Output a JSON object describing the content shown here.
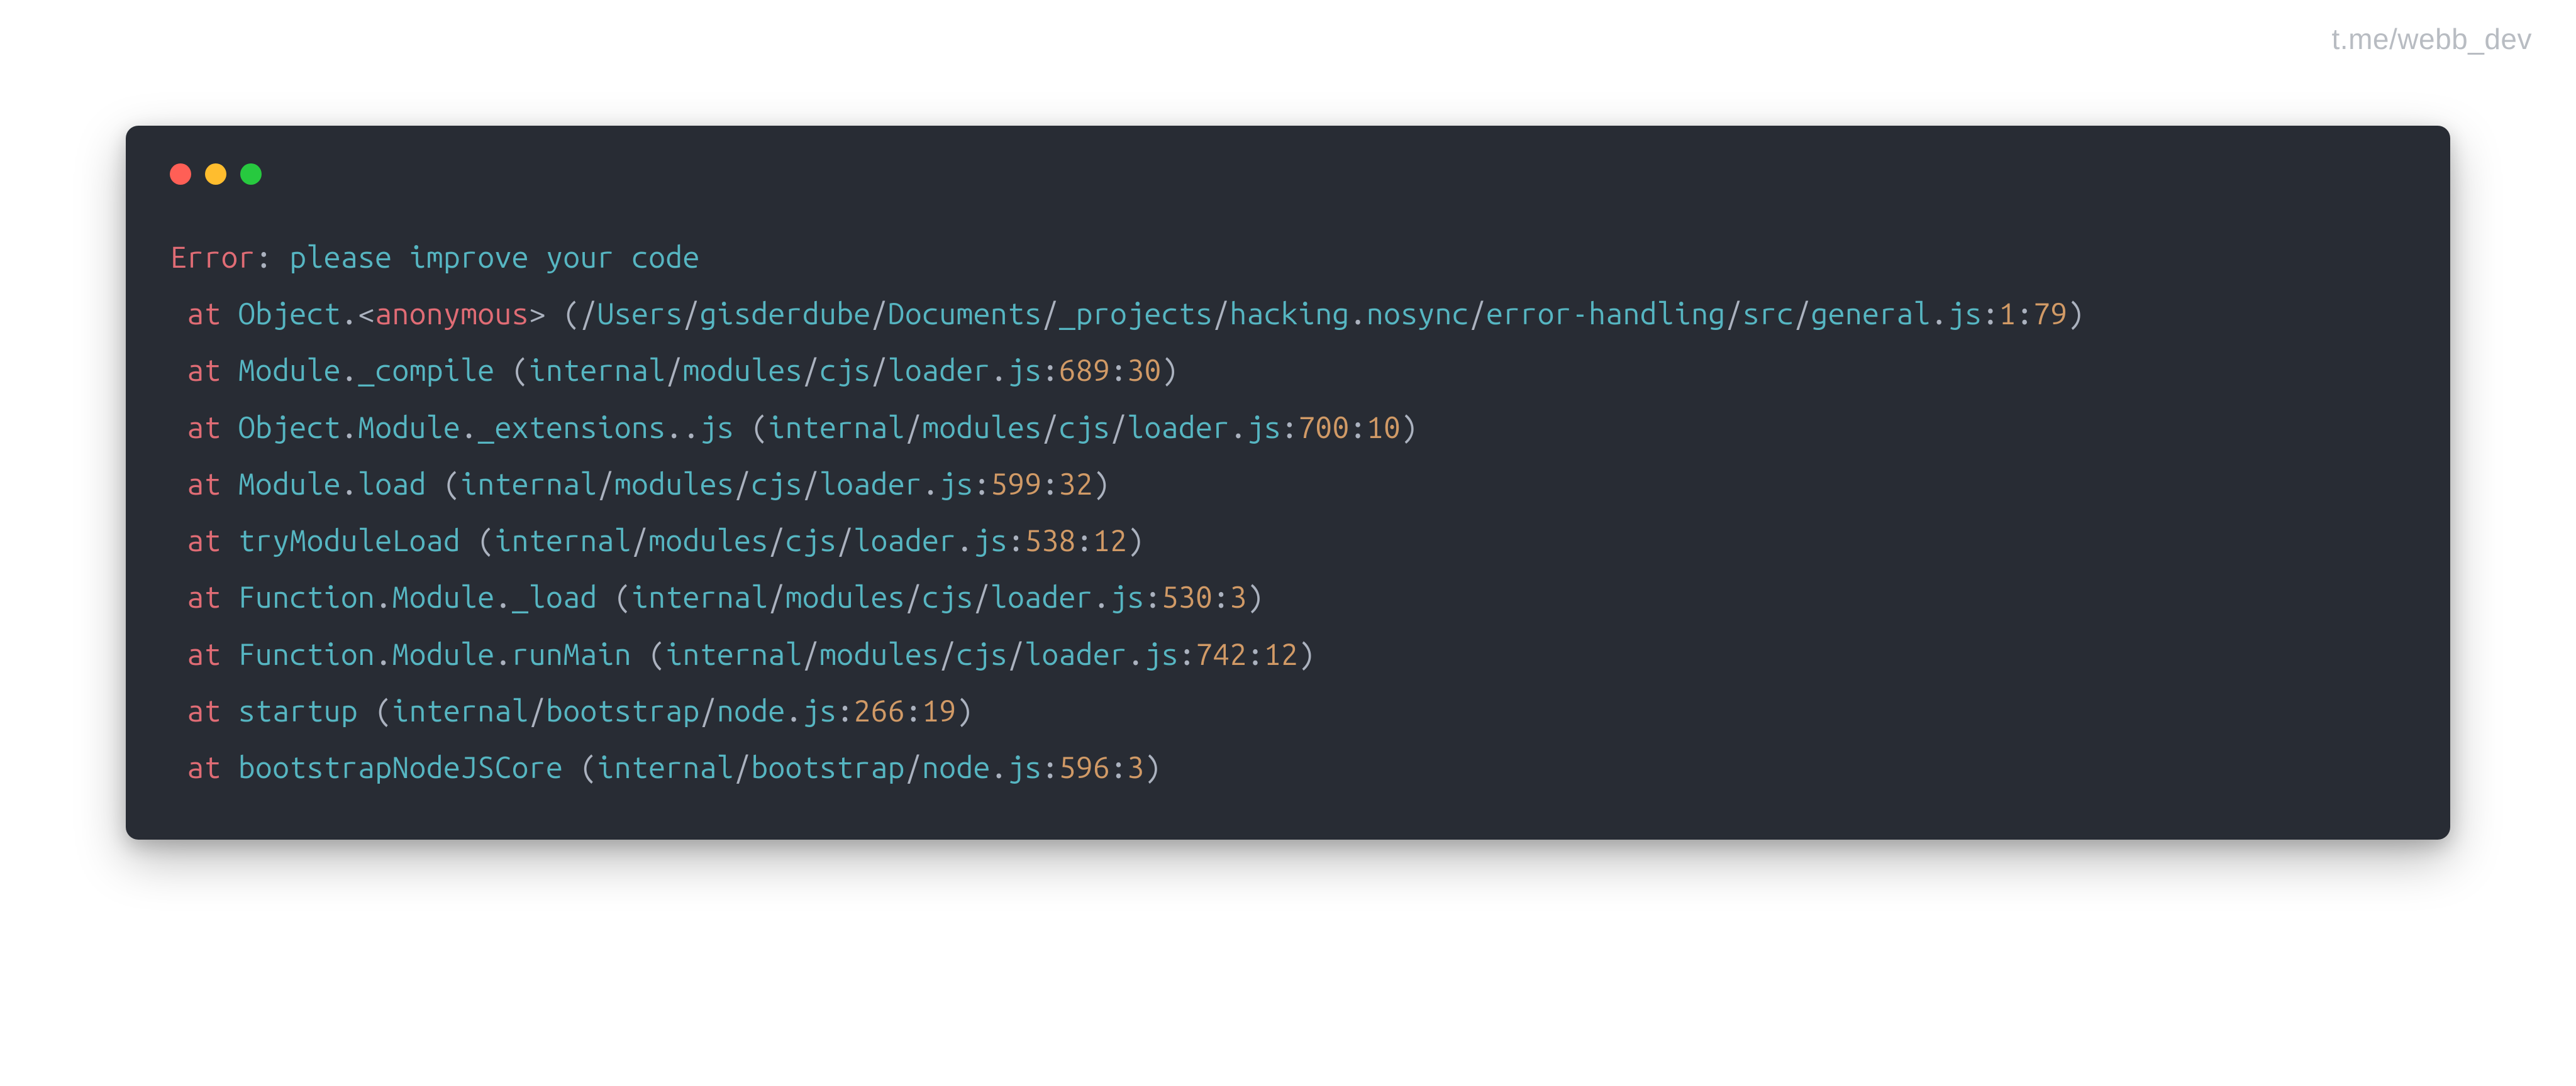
{
  "watermark": "t.me/webb_dev",
  "colors": {
    "bg": "#282c34",
    "red": "#e06c75",
    "gray": "#abb2bf",
    "teal": "#56b6c2",
    "orange": "#d19a66",
    "green": "#98c379"
  },
  "traffic": {
    "close": "#ff5f56",
    "min": "#ffbd2e",
    "max": "#27c93f"
  },
  "error": {
    "label": "Error",
    "message": "please improve your code",
    "stack": [
      {
        "fn": "Object.<anonymous>",
        "path": "/Users/gisderdube/Documents/_projects/hacking.nosync/error-handling/src/general.js",
        "line": 1,
        "col": 79
      },
      {
        "fn": "Module._compile",
        "path": "internal/modules/cjs/loader.js",
        "line": 689,
        "col": 30
      },
      {
        "fn": "Object.Module._extensions..js",
        "path": "internal/modules/cjs/loader.js",
        "line": 700,
        "col": 10
      },
      {
        "fn": "Module.load",
        "path": "internal/modules/cjs/loader.js",
        "line": 599,
        "col": 32
      },
      {
        "fn": "tryModuleLoad",
        "path": "internal/modules/cjs/loader.js",
        "line": 538,
        "col": 12
      },
      {
        "fn": "Function.Module._load",
        "path": "internal/modules/cjs/loader.js",
        "line": 530,
        "col": 3
      },
      {
        "fn": "Function.Module.runMain",
        "path": "internal/modules/cjs/loader.js",
        "line": 742,
        "col": 12
      },
      {
        "fn": "startup",
        "path": "internal/bootstrap/node.js",
        "line": 266,
        "col": 19
      },
      {
        "fn": "bootstrapNodeJSCore",
        "path": "internal/bootstrap/node.js",
        "line": 596,
        "col": 3
      }
    ]
  }
}
